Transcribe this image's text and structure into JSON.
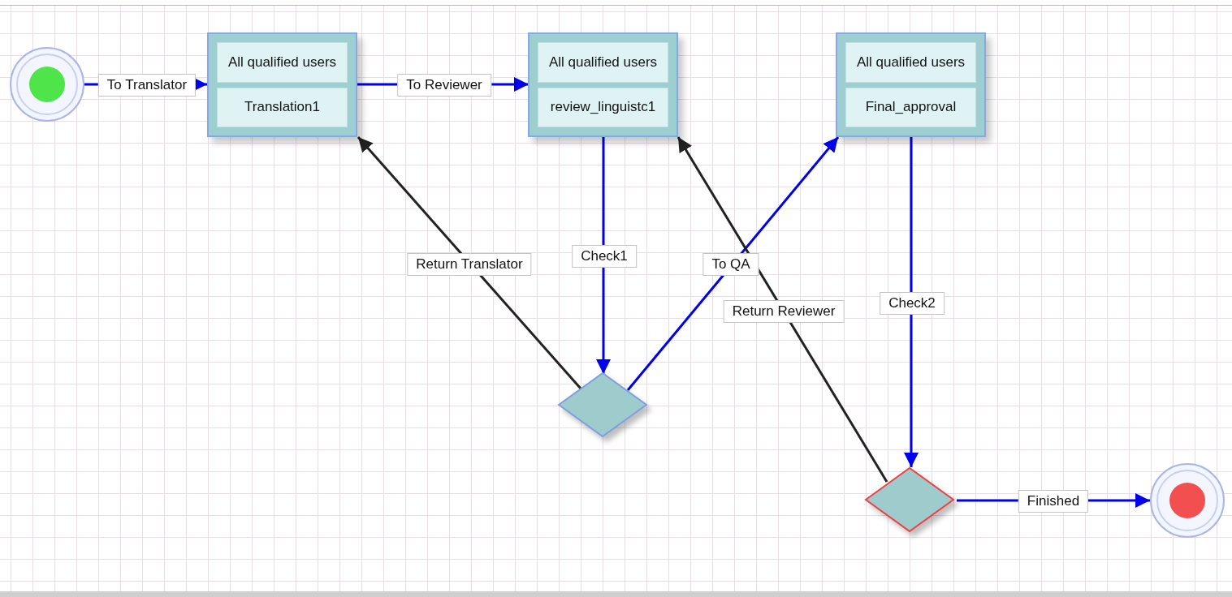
{
  "diagram": {
    "nodes": [
      {
        "kind": "start"
      },
      {
        "kind": "task",
        "assignee": "All qualified users",
        "name": "Translation1"
      },
      {
        "kind": "task",
        "assignee": "All qualified users",
        "name": "review_linguistc1"
      },
      {
        "kind": "task",
        "assignee": "All qualified users",
        "name": "Final_approval"
      },
      {
        "kind": "decision",
        "highlighted": false
      },
      {
        "kind": "decision",
        "highlighted": true
      },
      {
        "kind": "end"
      }
    ],
    "edges": [
      {
        "label": "To Translator",
        "color": "#0000ee"
      },
      {
        "label": "To Reviewer",
        "color": "#0000ee"
      },
      {
        "label": "Check1",
        "color": "#0000ee"
      },
      {
        "label": "Return Translator",
        "color": "#222222"
      },
      {
        "label": "To QA",
        "color": "#0000ee"
      },
      {
        "label": "Return Reviewer",
        "color": "#222222"
      },
      {
        "label": "Check2",
        "color": "#0000ee"
      },
      {
        "label": "Finished",
        "color": "#0000ee"
      }
    ]
  }
}
